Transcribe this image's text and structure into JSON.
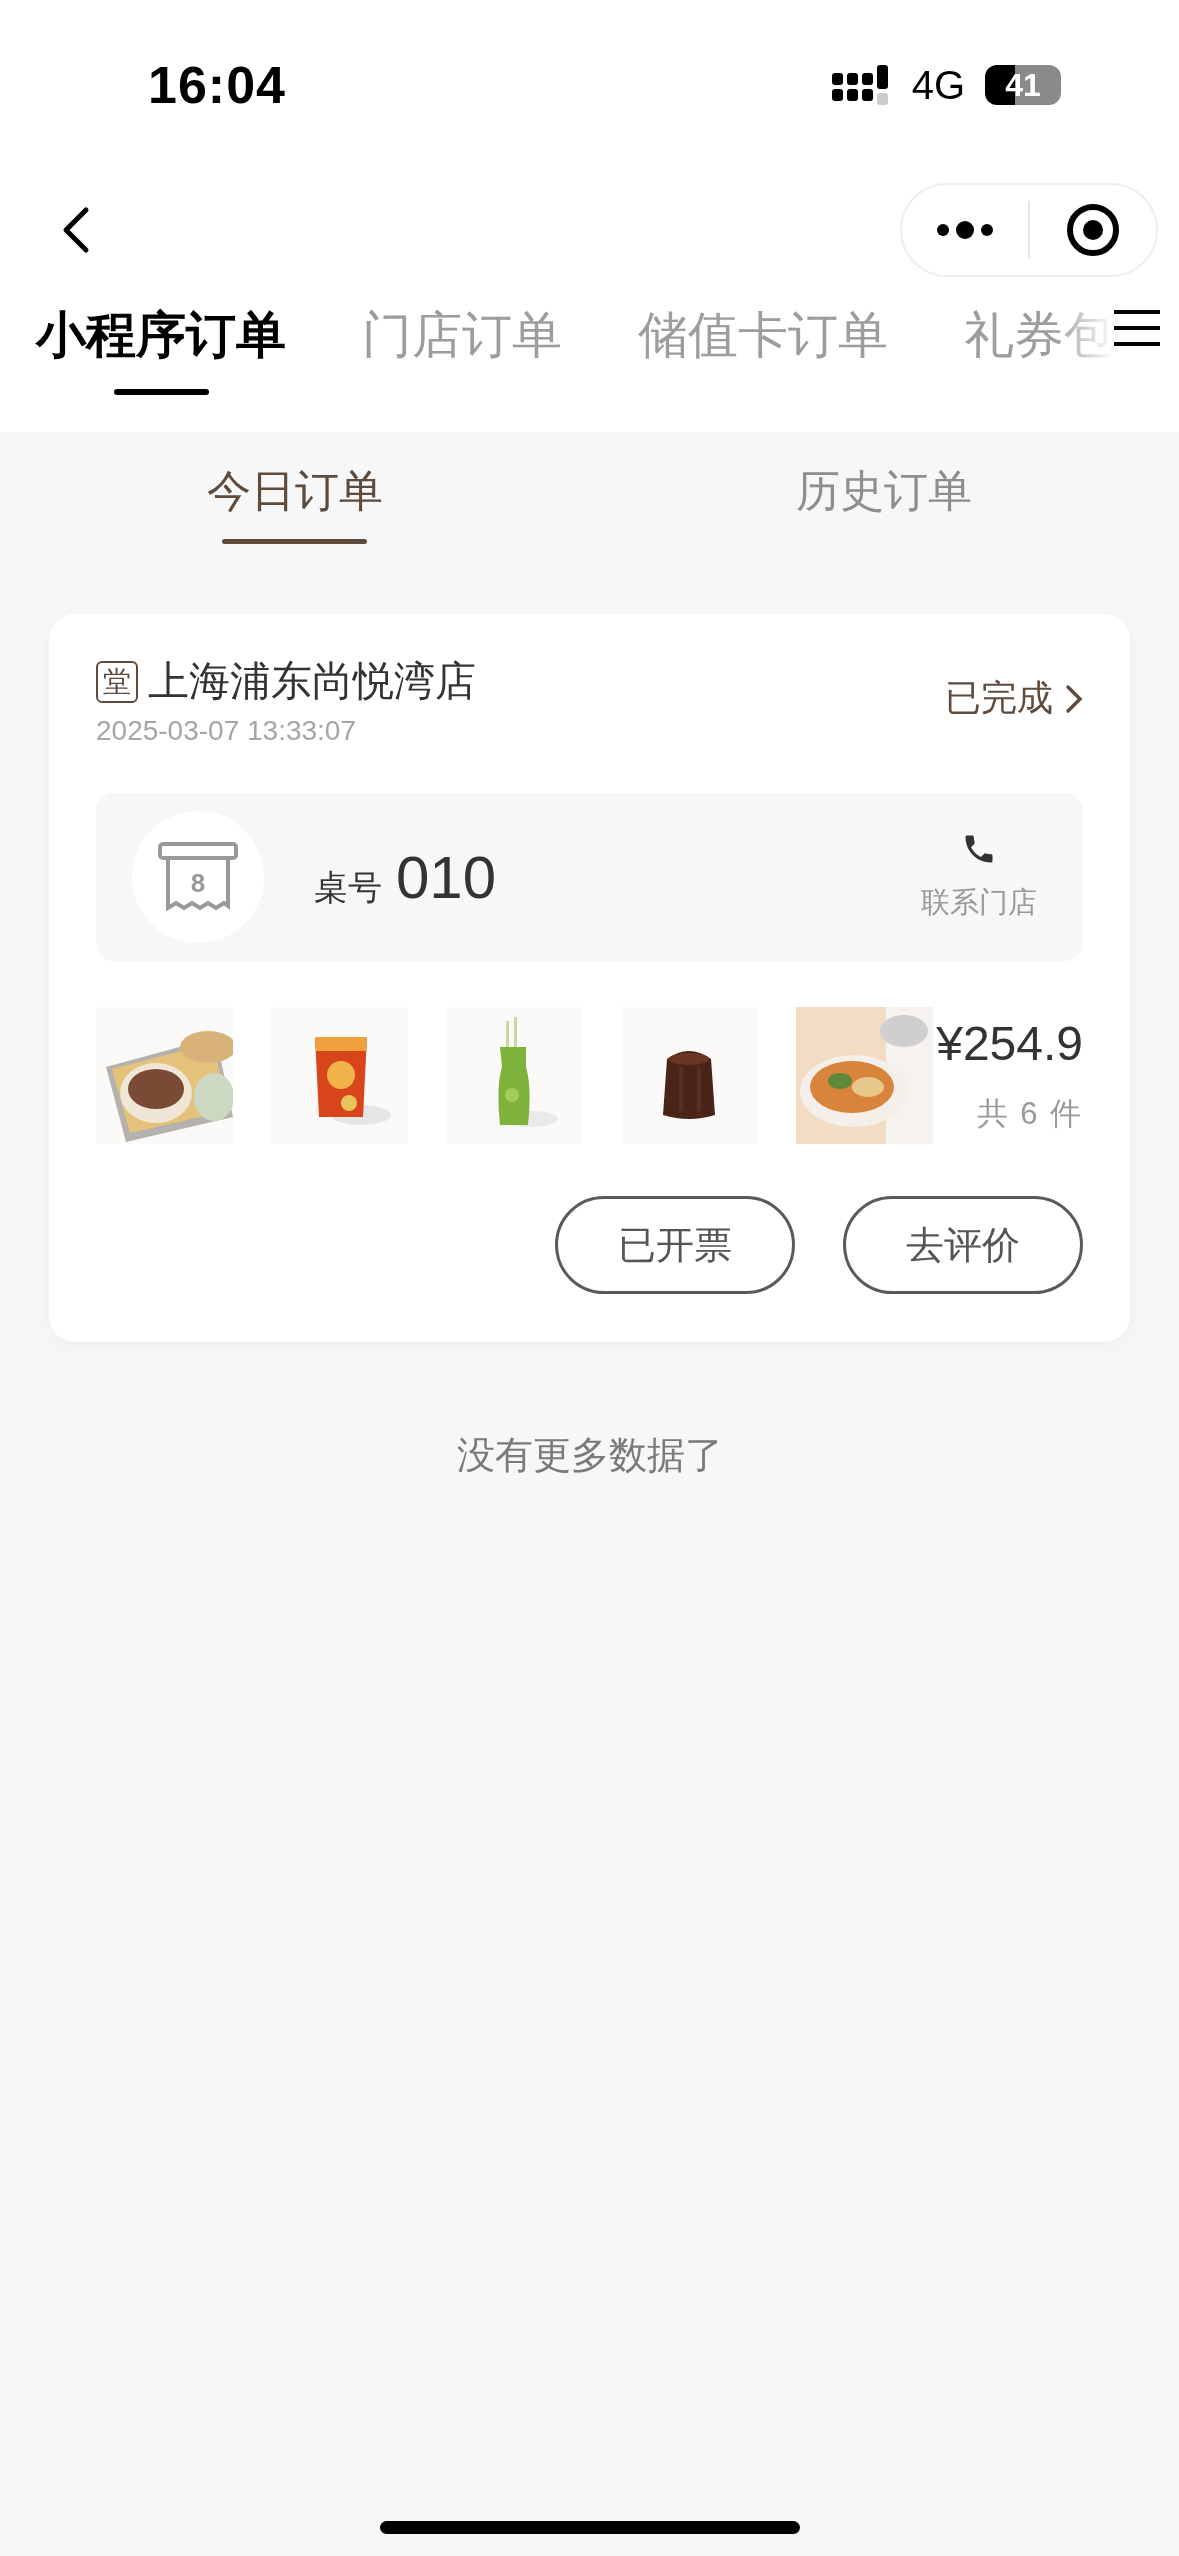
{
  "status_bar": {
    "time": "16:04",
    "network": "4G",
    "battery": "41"
  },
  "main_tabs": [
    {
      "label": "小程序订单",
      "selected": true
    },
    {
      "label": "门店订单",
      "selected": false
    },
    {
      "label": "储值卡订单",
      "selected": false
    },
    {
      "label": "礼券包",
      "selected": false
    }
  ],
  "sub_tabs": [
    {
      "label": "今日订单",
      "selected": true
    },
    {
      "label": "历史订单",
      "selected": false
    }
  ],
  "orders": [
    {
      "store_badge": "堂",
      "store": "上海浦东尚悦湾店",
      "time": "2025-03-07 13:33:07",
      "status": "已完成",
      "table_icon_number": "8",
      "table_label": "桌号",
      "table_number": "010",
      "contact": "联系门店",
      "price": "¥254.9",
      "count": "共 6 件",
      "buttons": [
        "已开票",
        "去评价"
      ]
    }
  ],
  "footer_note": "没有更多数据了"
}
